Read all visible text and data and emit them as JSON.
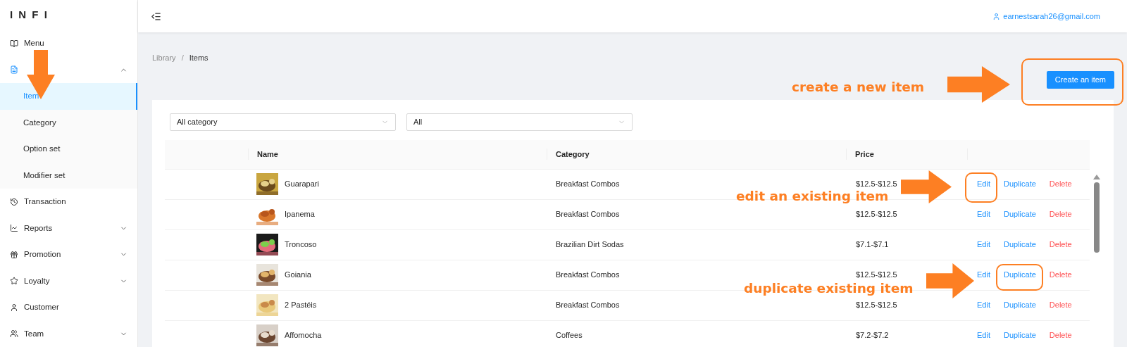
{
  "logo": "I N F I",
  "sidebar": {
    "items": [
      {
        "label": "Menu"
      },
      {
        "expanded": true,
        "children": [
          {
            "label": "Item",
            "selected": true
          },
          {
            "label": "Category",
            "selected": false
          },
          {
            "label": "Option set",
            "selected": false
          },
          {
            "label": "Modifier set",
            "selected": false
          }
        ]
      },
      {
        "label": "Transaction"
      },
      {
        "label": "Reports",
        "expanded": false
      },
      {
        "label": "Promotion",
        "expanded": false
      },
      {
        "label": "Loyalty",
        "expanded": false
      },
      {
        "label": "Customer"
      },
      {
        "label": "Team",
        "expanded": false
      }
    ]
  },
  "header": {
    "user": "earnestsarah26@gmail.com"
  },
  "breadcrumb": [
    "Library",
    "Items"
  ],
  "breadcrumb_separator": "/",
  "create_button": "Create an item",
  "filters": [
    {
      "value": "All category"
    },
    {
      "value": "All"
    }
  ],
  "table": {
    "columns": [
      "Name",
      "Category",
      "Price"
    ],
    "rows": [
      {
        "name": "Guarapari",
        "category": "Breakfast Combos",
        "price": "$12.5-$12.5",
        "actions": [
          "Edit",
          "Duplicate",
          "Delete"
        ]
      },
      {
        "name": "Ipanema",
        "category": "Breakfast Combos",
        "price": "$12.5-$12.5",
        "actions": [
          "Edit",
          "Duplicate",
          "Delete"
        ]
      },
      {
        "name": "Troncoso",
        "category": "Brazilian Dirt Sodas",
        "price": "$7.1-$7.1",
        "actions": [
          "Edit",
          "Duplicate",
          "Delete"
        ]
      },
      {
        "name": "Goiania",
        "category": "Breakfast Combos",
        "price": "$12.5-$12.5",
        "actions": [
          "Edit",
          "Duplicate",
          "Delete"
        ]
      },
      {
        "name": "2 Pastéis",
        "category": "Breakfast Combos",
        "price": "$12.5-$12.5",
        "actions": [
          "Edit",
          "Duplicate",
          "Delete"
        ]
      },
      {
        "name": "Affomocha",
        "category": "Coffees",
        "price": "$7.2-$7.2",
        "actions": [
          "Edit",
          "Duplicate",
          "Delete"
        ]
      }
    ]
  },
  "annotations": [
    {
      "kind": "arrow-down"
    },
    {
      "kind": "callout",
      "text": "create a new item"
    },
    {
      "kind": "callout",
      "text": "edit an existing item"
    },
    {
      "kind": "callout",
      "text": "duplicate existing item"
    }
  ]
}
